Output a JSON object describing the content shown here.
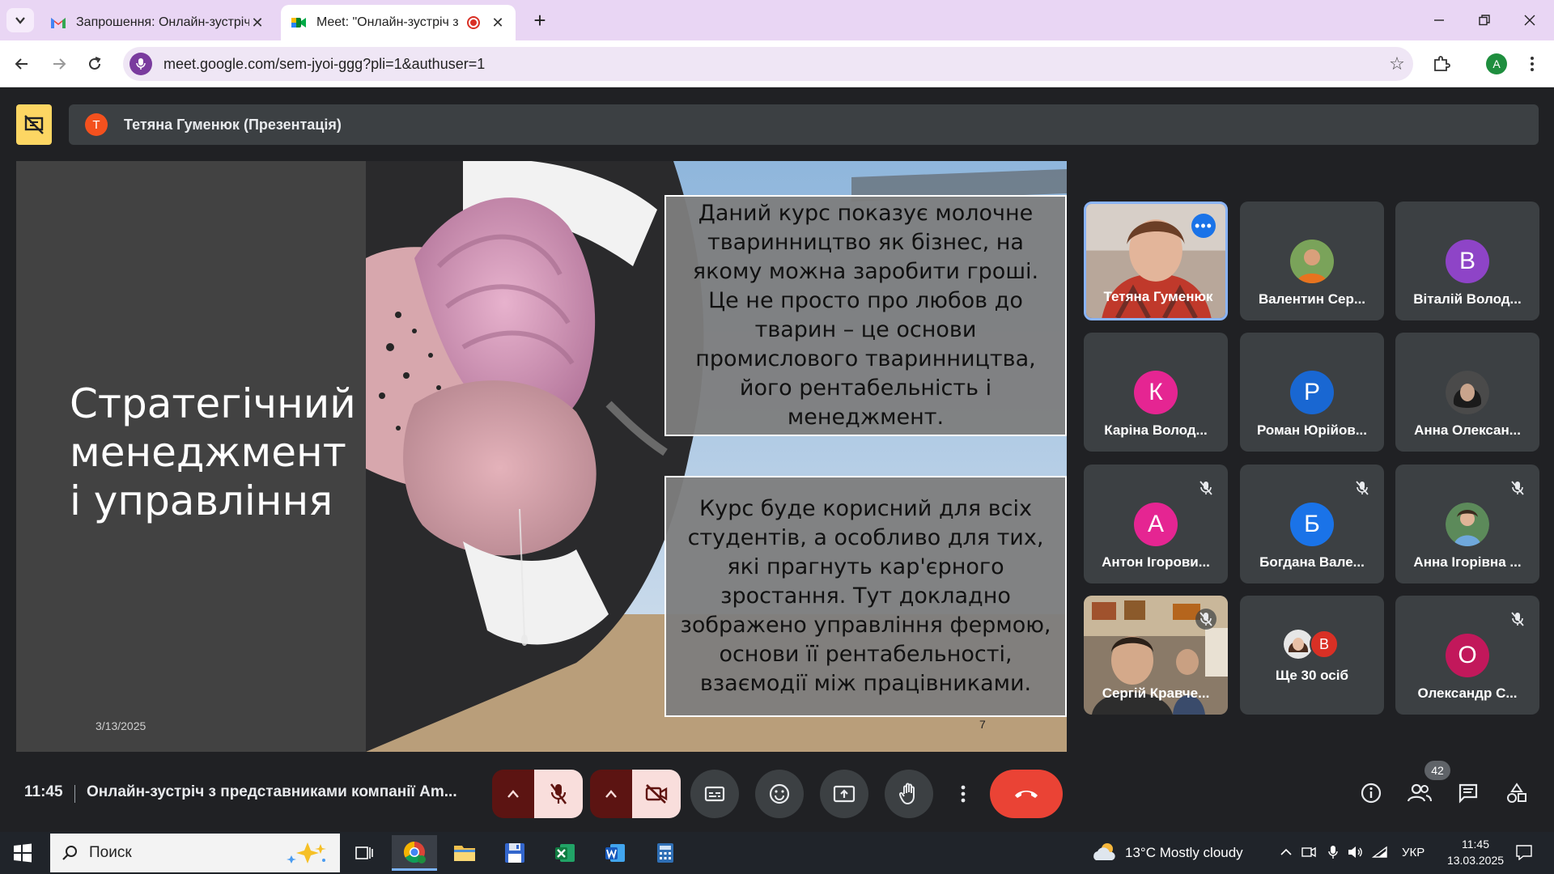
{
  "browser": {
    "tabs": [
      {
        "label": "Запрошення: Онлайн-зустріч з...",
        "icon": "gmail-icon"
      },
      {
        "label": "Meet: \"Онлайн-зустріч з пр...",
        "icon": "meet-icon",
        "recording": true
      }
    ],
    "url": "meet.google.com/sem-jyoi-ggg?pli=1&authuser=1",
    "profile_initial": "A"
  },
  "presentation": {
    "presenter_initial": "T",
    "presenter_label": "Тетяна Гуменюк (Презентація)",
    "slide": {
      "title_line1": "Стратегічний",
      "title_line2": "менеджмент",
      "title_line3": "і управління",
      "date": "3/13/2025",
      "page_number": "7",
      "text_box_1": "Даний курс показує молочне тваринництво як бізнес, на якому можна заробити гроші. Це не просто про любов до тварин – це основи промислового тваринництва, його рентабельність і менеджмент.",
      "text_box_2": "Курс буде корисний для всіх студентів, а особливо для тих, які прагнуть кар'єрного зростання. Тут докладно зображено управління фермою, основи її рентабельності, взаємодії між працівниками."
    }
  },
  "participants": [
    {
      "name": "Тетяна Гуменюк",
      "type": "video",
      "active": true
    },
    {
      "name": "Валентин Сер...",
      "type": "photo"
    },
    {
      "name": "Віталій Волод...",
      "initial": "В",
      "color": "#8e44c7"
    },
    {
      "name": "Каріна Волод...",
      "initial": "К",
      "color": "#e52592"
    },
    {
      "name": "Роман Юрійов...",
      "initial": "Р",
      "color": "#1967d2"
    },
    {
      "name": "Анна Олексан...",
      "type": "photo"
    },
    {
      "name": "Антон Ігорови...",
      "initial": "А",
      "color": "#e52592",
      "muted": true
    },
    {
      "name": "Богдана Вале...",
      "initial": "Б",
      "color": "#1a73e8",
      "muted": true
    },
    {
      "name": "Анна Ігорівна ...",
      "type": "photo",
      "muted": true
    },
    {
      "name": "Сергій Кравче...",
      "type": "video",
      "muted": true
    },
    {
      "name": "Ще 30 осіб",
      "type": "more",
      "mini_initial": "В"
    },
    {
      "name": "Олександр С...",
      "initial": "О",
      "color": "#c2185b",
      "muted": true
    }
  ],
  "controls": {
    "time": "11:45",
    "meeting_title": "Онлайн-зустріч з представниками компанії Am...",
    "participant_count": "42"
  },
  "taskbar": {
    "search_placeholder": "Поиск",
    "weather": "13°C  Mostly cloudy",
    "language": "УКР",
    "clock_time": "11:45",
    "clock_date": "13.03.2025"
  }
}
